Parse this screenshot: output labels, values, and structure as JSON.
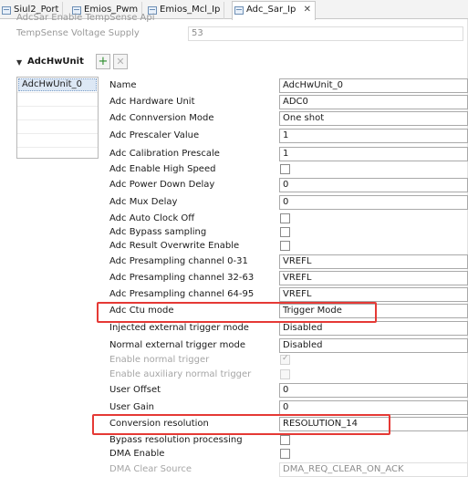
{
  "tabs": [
    {
      "label": "Siul2_Port",
      "active": false
    },
    {
      "label": "Emios_Pwm",
      "active": false
    },
    {
      "label": "Emios_Mcl_Ip",
      "active": false
    },
    {
      "label": "Adc_Sar_Ip",
      "active": true,
      "close": "✕"
    }
  ],
  "top_properties": [
    {
      "label": "AdcSar Enable TempSense Api",
      "value": ""
    },
    {
      "label": "TempSense Voltage Supply",
      "value": "53"
    }
  ],
  "section": {
    "caret": "▼",
    "title": "AdcHwUnit",
    "add_glyph": "+",
    "remove_glyph": "✕",
    "items": [
      "AdcHwUnit_0"
    ]
  },
  "fields": [
    {
      "label": "Name",
      "type": "text",
      "value": "AdcHwUnit_0"
    },
    {
      "label": "Adc Hardware Unit",
      "type": "text",
      "value": "ADC0"
    },
    {
      "label": "Adc Connversion Mode",
      "type": "text",
      "value": "One shot"
    },
    {
      "label": "Adc Prescaler Value",
      "type": "text",
      "value": "1"
    },
    {
      "label": "Adc Calibration Prescale",
      "type": "text",
      "value": "1"
    },
    {
      "label": "Adc Enable High Speed",
      "type": "checkbox",
      "checked": false
    },
    {
      "label": "Adc Power Down Delay",
      "type": "text",
      "value": "0"
    },
    {
      "label": "Adc Mux Delay",
      "type": "text",
      "value": "0"
    },
    {
      "label": "Adc Auto Clock Off",
      "type": "checkbox",
      "checked": false
    },
    {
      "label": "Adc Bypass sampling",
      "type": "checkbox",
      "checked": false
    },
    {
      "label": "Adc Result Overwrite Enable",
      "type": "checkbox",
      "checked": false
    },
    {
      "label": "Adc Presampling channel 0-31",
      "type": "text",
      "value": "VREFL"
    },
    {
      "label": "Adc Presampling channel 32-63",
      "type": "text",
      "value": "VREFL"
    },
    {
      "label": "Adc Presampling channel 64-95",
      "type": "text",
      "value": "VREFL"
    },
    {
      "label": "Adc Ctu mode",
      "type": "text",
      "value": "Trigger Mode"
    },
    {
      "label": "Injected external trigger mode",
      "type": "text",
      "value": "Disabled"
    },
    {
      "label": "Normal external trigger mode",
      "type": "text",
      "value": "Disabled"
    },
    {
      "label": "Enable normal trigger",
      "type": "checkbox",
      "checked": true,
      "disabled": true
    },
    {
      "label": "Enable auxiliary normal trigger",
      "type": "checkbox",
      "checked": false,
      "disabled": true
    },
    {
      "label": "User Offset",
      "type": "text",
      "value": "0"
    },
    {
      "label": "User Gain",
      "type": "text",
      "value": "0"
    },
    {
      "label": "Conversion resolution",
      "type": "text",
      "value": "RESOLUTION_14"
    },
    {
      "label": "Bypass resolution processing",
      "type": "checkbox",
      "checked": false
    },
    {
      "label": "DMA Enable",
      "type": "checkbox",
      "checked": false
    },
    {
      "label": "DMA Clear Source",
      "type": "text",
      "value": "DMA_REQ_CLEAR_ON_ACK",
      "disabled": true
    }
  ],
  "colors": {
    "highlight": "#e53935",
    "selection": "#dde8f5",
    "disabled_text": "#a6a6a6"
  }
}
